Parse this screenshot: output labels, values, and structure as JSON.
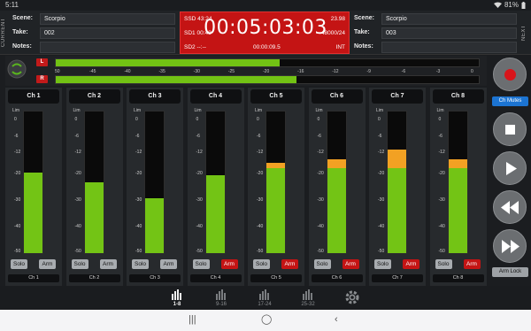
{
  "status": {
    "time": "5:11",
    "battery": "81%"
  },
  "current": {
    "side_label": "CURRENT",
    "scene_label": "Scene:",
    "scene": "Scorpio",
    "take_label": "Take:",
    "take": "002",
    "notes_label": "Notes:",
    "notes": ""
  },
  "next": {
    "side_label": "NEXT",
    "scene_label": "Scene:",
    "scene": "Scorpio",
    "take_label": "Take:",
    "take": "003",
    "notes_label": "Notes:",
    "notes": ""
  },
  "timecode": {
    "ssd": "SSD 43:24",
    "sd1": "SD1 00:48",
    "sd2": "SD2 --:--",
    "main": "00:05:03:03",
    "fps": "23.98",
    "format": "48000/24",
    "duration": "00:00:09.5",
    "source": "INT"
  },
  "main_meters": {
    "left_label": "L",
    "right_label": "R",
    "left_level": 0.53,
    "right_level": 0.57,
    "scale": [
      "50",
      "-45",
      "-40",
      "-35",
      "-30",
      "-25",
      "-20",
      "-16",
      "-12",
      "-9",
      "-6",
      "-3",
      "0"
    ]
  },
  "channel_scale": [
    "Lim",
    "0",
    "-6",
    "-12",
    "-20",
    "-30",
    "-40",
    "-50"
  ],
  "channels": [
    {
      "name": "Ch 1",
      "footer": "Ch 1",
      "level": 0.57,
      "peak": 0.0,
      "solo": "Solo",
      "arm": "Arm",
      "armed": false
    },
    {
      "name": "Ch 2",
      "footer": "Ch 2",
      "level": 0.5,
      "peak": 0.0,
      "solo": "Solo",
      "arm": "Arm",
      "armed": false
    },
    {
      "name": "Ch 3",
      "footer": "Ch 3",
      "level": 0.39,
      "peak": 0.0,
      "solo": "Solo",
      "arm": "Arm",
      "armed": false
    },
    {
      "name": "Ch 4",
      "footer": "Ch 4",
      "level": 0.55,
      "peak": 0.0,
      "solo": "Solo",
      "arm": "Arm",
      "armed": true
    },
    {
      "name": "Ch 5",
      "footer": "Ch 5",
      "level": 0.6,
      "peak": 0.04,
      "solo": "Solo",
      "arm": "Arm",
      "armed": true
    },
    {
      "name": "Ch 6",
      "footer": "Ch 6",
      "level": 0.6,
      "peak": 0.06,
      "solo": "Solo",
      "arm": "Arm",
      "armed": true
    },
    {
      "name": "Ch 7",
      "footer": "Ch 7",
      "level": 0.6,
      "peak": 0.13,
      "solo": "Solo",
      "arm": "Arm",
      "armed": true
    },
    {
      "name": "Ch 8",
      "footer": "Ch 8",
      "level": 0.6,
      "peak": 0.06,
      "solo": "Solo",
      "arm": "Arm",
      "armed": true
    }
  ],
  "side": {
    "ch_mutes": "Ch Mutes",
    "arm_lock": "Arm Lock"
  },
  "tabs": [
    {
      "label": "1-8",
      "active": true
    },
    {
      "label": "9-16",
      "active": false
    },
    {
      "label": "17-24",
      "active": false
    },
    {
      "label": "25-32",
      "active": false
    }
  ],
  "colors": {
    "record_red": "#c41414",
    "meter_green": "#73c415",
    "meter_orange": "#f2a123",
    "accent_blue": "#1c74d2"
  }
}
